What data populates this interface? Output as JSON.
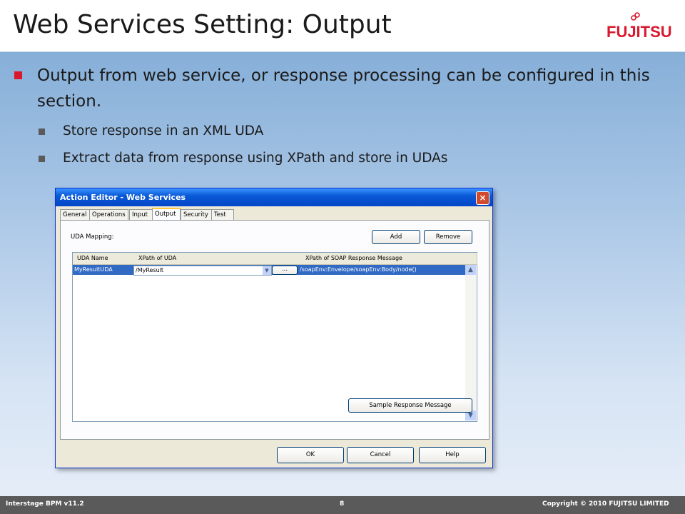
{
  "slide": {
    "title": "Web Services Setting: Output",
    "logo_text": "FUJITSU",
    "accent_color": "#d9182d",
    "bullet": "Output from web service, or response processing can be configured in this section.",
    "sub_bullets": [
      "Store response in an XML UDA",
      "Extract data from response using XPath and store in UDAs"
    ]
  },
  "dialog": {
    "title": "Action Editor - Web Services",
    "close_icon": "×",
    "tabs": [
      "General",
      "Operations",
      "Input",
      "Output",
      "Security",
      "Test"
    ],
    "active_tab": "Output",
    "uda_mapping_label": "UDA Mapping:",
    "add_label": "Add",
    "remove_label": "Remove",
    "columns": [
      "UDA Name",
      "XPath of UDA",
      "XPath of SOAP Response Message"
    ],
    "rows": [
      {
        "uda_name": "MyResultUDA",
        "xpath_uda": "/MyResult",
        "browse": "...",
        "xpath_soap": "/soapEnv:Envelope/soapEnv:Body/node()"
      }
    ],
    "sample_button_label": "Sample Response Message",
    "ok_label": "OK",
    "cancel_label": "Cancel",
    "help_label": "Help"
  },
  "footer": {
    "left": "Interstage BPM v11.2",
    "page": "8",
    "right": "Copyright © 2010 FUJITSU LIMITED"
  }
}
